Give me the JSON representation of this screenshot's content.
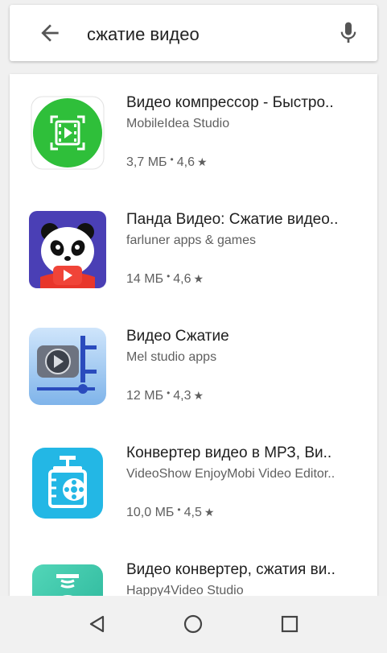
{
  "search": {
    "query": "сжатие видео",
    "back_icon": "arrow-back-icon",
    "mic_icon": "microphone-icon"
  },
  "results": [
    {
      "title": "Видео компрессор - Быстро..",
      "developer": "MobileIdea Studio",
      "size": "3,7 МБ",
      "rating": "4,6",
      "icon": "video-compressor-icon",
      "icon_color": "#2fbf3a"
    },
    {
      "title": "Панда Видео: Сжатие видео..",
      "developer": "farluner apps & games",
      "size": "14 МБ",
      "rating": "4,6",
      "icon": "panda-video-icon",
      "icon_color": "#4a3fb5"
    },
    {
      "title": "Видео Сжатие",
      "developer": "Mel studio apps",
      "size": "12 МБ",
      "rating": "4,3",
      "icon": "video-clamp-icon",
      "icon_color": "#8ec0ee"
    },
    {
      "title": "Конвертер видео в МРЗ, Ви..",
      "developer": "VideoShow EnjoyMobi Video Editor..",
      "size": "10,0 МБ",
      "rating": "4,5",
      "icon": "video-converter-icon",
      "icon_color": "#23b7e5"
    },
    {
      "title": "Видео конвертер, сжатия ви..",
      "developer": "Happy4Video Studio",
      "size": "",
      "rating": "",
      "icon": "video-converter-press-icon",
      "icon_color": "#3cc9a8"
    }
  ],
  "navbar": {
    "back_icon": "nav-back-triangle-icon",
    "home_icon": "nav-home-circle-icon",
    "recents_icon": "nav-recents-square-icon"
  }
}
